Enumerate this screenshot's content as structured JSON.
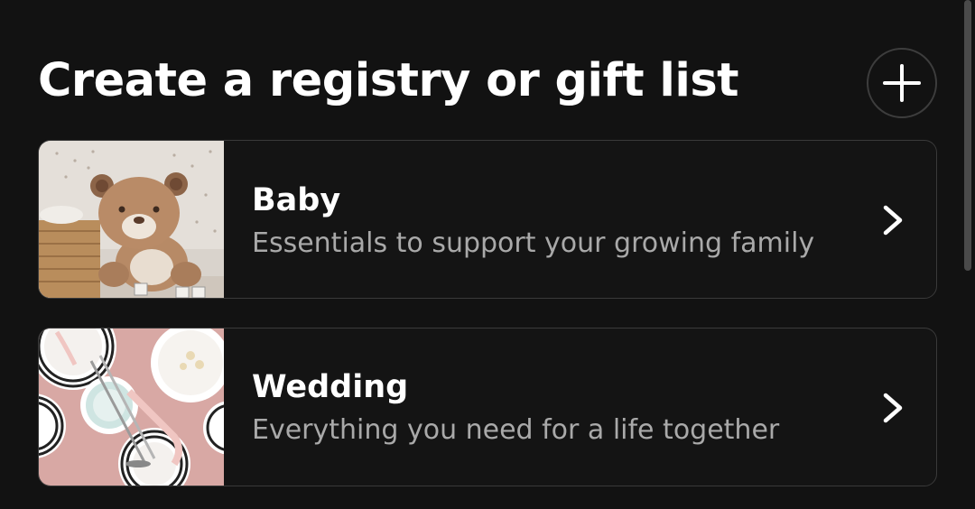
{
  "header": {
    "title": "Create a registry or gift list",
    "add_icon": "plus-icon"
  },
  "registry_types": [
    {
      "title": "Baby",
      "description": "Essentials to support your growing family",
      "image": "teddy-bear-nursery-photo",
      "icon": "chevron-right-icon"
    },
    {
      "title": "Wedding",
      "description": "Everything you need for a life together",
      "image": "wedding-table-setting-photo",
      "icon": "chevron-right-icon"
    }
  ],
  "colors": {
    "background": "#121212",
    "card_border": "#3a3a3a",
    "text_primary": "#ffffff",
    "text_secondary": "#a9a9a9"
  }
}
